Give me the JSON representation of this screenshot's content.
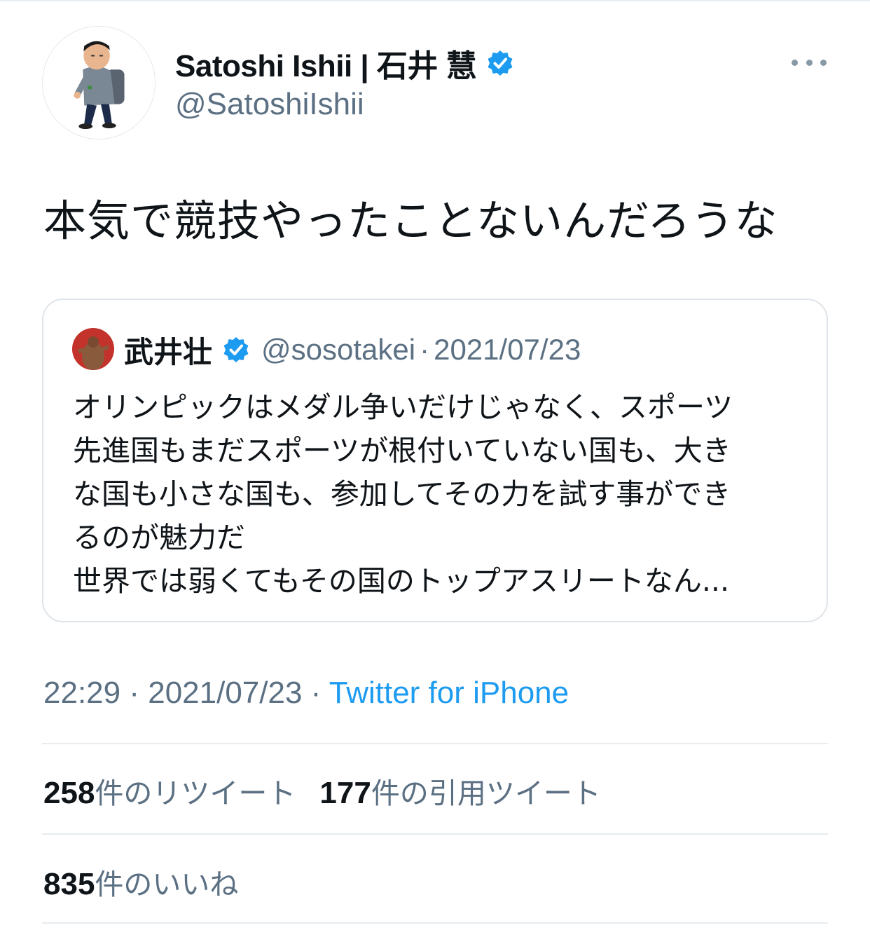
{
  "author": {
    "display_name": "Satoshi Ishii | 石井 慧",
    "handle": "@SatoshiIshii"
  },
  "tweet": {
    "text": "本気で競技やったことないんだろうな"
  },
  "quoted": {
    "name": "武井壮",
    "handle": "@sosotakei",
    "separator": "·",
    "date": "2021/07/23",
    "lines": [
      "オリンピックはメダル争いだけじゃなく、スポーツ",
      "先進国もまだスポーツが根付いていない国も、大き",
      "な国も小さな国も、参加してその力を試す事ができ",
      "るのが魅力だ",
      "世界では弱くてもその国のトップアスリートなん..."
    ]
  },
  "meta": {
    "time": "22:29",
    "sep1": " · ",
    "date": "2021/07/23",
    "sep2": " · ",
    "source": "Twitter for iPhone"
  },
  "stats": {
    "retweets": {
      "count": "258",
      "label": "件のリツイート"
    },
    "quotes": {
      "count": "177",
      "label": "件の引用ツイート"
    },
    "likes": {
      "count": "835",
      "label": "件のいいね"
    }
  },
  "colors": {
    "verified": "#1d9bf0",
    "secondary_text": "#5b7083",
    "link": "#1d9bf0"
  },
  "icons": [
    "verified-badge-icon",
    "more-options-icon"
  ]
}
